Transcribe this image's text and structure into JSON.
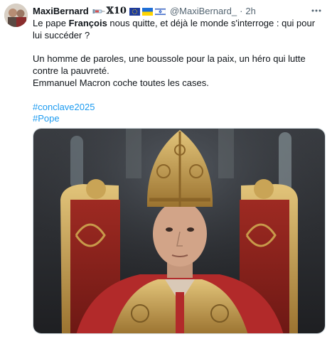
{
  "author": {
    "display_name": "MaxiBernard",
    "badge_text": "𝕏10",
    "handle": "@MaxiBernard_",
    "separator": "·",
    "timestamp": "2h"
  },
  "icons": {
    "avatar": "profile-photo",
    "syringe": "syringe-emoji",
    "flag_eu": "eu-flag-emoji",
    "flag_ua": "ukraine-flag-emoji",
    "flag_il": "israel-flag-emoji",
    "more": "more-options-icon"
  },
  "tweet": {
    "line1_pre": "Le pape ",
    "line1_bold": "François",
    "line1_post": " nous quitte, et déjà le monde s'interroge : qui pour lui succéder ?",
    "line2": "Un homme de paroles, une boussole pour la paix, un héro qui lutte contre la pauvreté.",
    "line3": "Emmanuel Macron coche toutes les cases.",
    "hashtags": [
      "#conclave2025",
      "#Pope"
    ]
  },
  "colors": {
    "link": "#1d9bf0",
    "text": "#0f1419",
    "secondary": "#536471"
  }
}
